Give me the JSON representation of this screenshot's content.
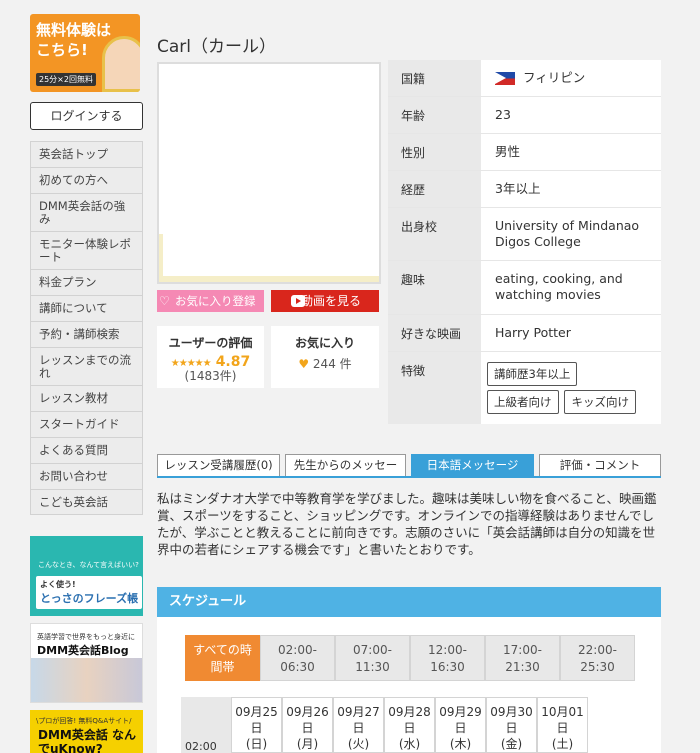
{
  "sidebar": {
    "promo": {
      "line1": "無料体験は",
      "line2": "こちら!",
      "sub": "25分×2回無料"
    },
    "login_label": "ログインする",
    "nav": [
      {
        "label": "英会話トップ"
      },
      {
        "label": "初めての方へ"
      },
      {
        "label": "DMM英会話の強み"
      },
      {
        "label": "モニター体験レポート"
      },
      {
        "label": "料金プラン"
      },
      {
        "label": "講師について"
      },
      {
        "label": "予約・講師検索"
      },
      {
        "label": "レッスンまでの流れ"
      },
      {
        "label": "レッスン教材"
      },
      {
        "label": "スタートガイド"
      },
      {
        "label": "よくある質問"
      },
      {
        "label": "お問い合わせ"
      },
      {
        "label": "こども英会話"
      }
    ],
    "banners": {
      "phrase": {
        "tag": "こんなとき、なんて言えばいい?",
        "main": "とっさのフレーズ帳",
        "sub": "よく使う!"
      },
      "blog": {
        "tag": "英語学習で世界をもっと身近に",
        "main": "DMM英会話Blog"
      },
      "qa": {
        "tag": "\\プロが回答! 無料Q&Aサイト/",
        "main": "DMM英会話 なんでuKnow?"
      }
    }
  },
  "teacher": {
    "name": "Carl（カール）",
    "fav_label": "お気に入り登録",
    "video_label": "動画を見る",
    "rating_label": "ユーザーの評価",
    "stars": "★★★★★",
    "score": "4.87",
    "rating_count": "(1483件)",
    "favorites_label": "お気に入り",
    "favorites_count": "244 件"
  },
  "info": {
    "nationality_label": "国籍",
    "nationality": "フィリピン",
    "age_label": "年齢",
    "age": "23",
    "gender_label": "性別",
    "gender": "男性",
    "career_label": "経歴",
    "career": "3年以上",
    "school_label": "出身校",
    "school": "University of Mindanao Digos College",
    "hobby_label": "趣味",
    "hobby": "eating, cooking, and watching movies",
    "movie_label": "好きな映画",
    "movie": "Harry Potter",
    "features_label": "特徴",
    "features": [
      "講師歴3年以上",
      "上級者向け",
      "キッズ向け"
    ]
  },
  "tabs": [
    {
      "label": "レッスン受講履歴(0)"
    },
    {
      "label": "先生からのメッセー"
    },
    {
      "label": "日本語メッセージ"
    },
    {
      "label": "評価・コメント"
    }
  ],
  "message": "私はミンダナオ大学で中等教育学を学びました。趣味は美味しい物を食べること、映画鑑賞、スポーツをすること、ショッピングです。オンラインでの指導経験はありませんでしたが、学ぶことと教えることに前向きです。志願のさいに「英会話講師は自分の知識を世界中の若者にシェアする機会です」と書いたとおりです。",
  "schedule": {
    "title": "スケジュール",
    "filters": [
      {
        "line1": "すべての時",
        "line2": "間帯"
      },
      {
        "line1": "02:00-",
        "line2": "06:30"
      },
      {
        "line1": "07:00-",
        "line2": "11:30"
      },
      {
        "line1": "12:00-",
        "line2": "16:30"
      },
      {
        "line1": "17:00-",
        "line2": "21:30"
      },
      {
        "line1": "22:00-",
        "line2": "25:30"
      }
    ],
    "time_label": "02:00",
    "dates": [
      {
        "date": "09月25",
        "day": "日",
        "dow": "(日)"
      },
      {
        "date": "09月26",
        "day": "日",
        "dow": "(月)"
      },
      {
        "date": "09月27",
        "day": "日",
        "dow": "(火)"
      },
      {
        "date": "09月28",
        "day": "日",
        "dow": "(水)"
      },
      {
        "date": "09月29",
        "day": "日",
        "dow": "(木)"
      },
      {
        "date": "09月30",
        "day": "日",
        "dow": "(金)"
      },
      {
        "date": "10月01",
        "day": "日",
        "dow": "(土)"
      }
    ]
  },
  "colors": {
    "accent_blue": "#39a0d8",
    "orange": "#f08a32",
    "pink": "#f589b4",
    "red": "#d9261c",
    "star": "#f2a51b"
  }
}
